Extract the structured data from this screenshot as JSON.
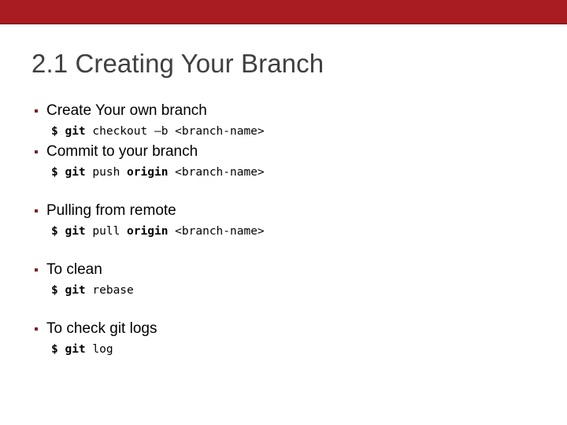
{
  "slide": {
    "title": "2.1 Creating Your Branch",
    "accent_color": "#a81c22",
    "bullet_color": "#7b2326",
    "title_color": "#404040",
    "background_color": "#ffffff"
  },
  "bullets": [
    {
      "label": "Create Your own branch",
      "code": {
        "prompt": "$ git ",
        "rest": "checkout –b <branch-name>",
        "emphasis": "",
        "tail": ""
      }
    },
    {
      "label": "Commit to your branch",
      "code": {
        "prompt": "$ git ",
        "rest": "push ",
        "emphasis": "origin",
        "tail": " <branch-name>"
      }
    },
    {
      "label": "Pulling from remote",
      "code": {
        "prompt": "$ git ",
        "rest": "pull ",
        "emphasis": "origin",
        "tail": " <branch-name>"
      }
    },
    {
      "label": "To clean",
      "code": {
        "prompt": "$ git ",
        "rest": "rebase",
        "emphasis": "",
        "tail": ""
      }
    },
    {
      "label": "To check git logs",
      "code": {
        "prompt": "$ git ",
        "rest": "log",
        "emphasis": "",
        "tail": ""
      }
    }
  ]
}
